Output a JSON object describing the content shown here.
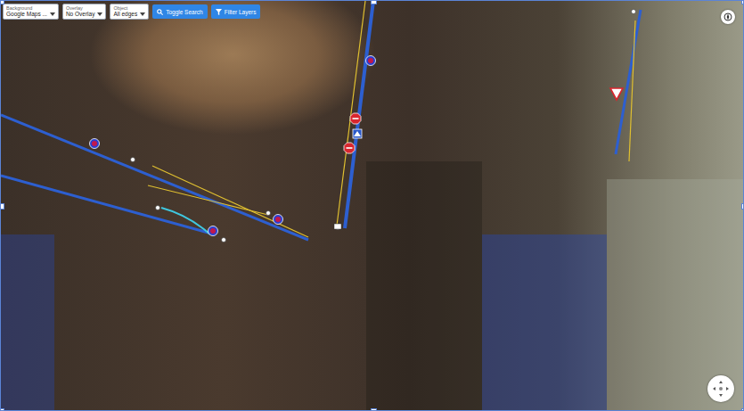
{
  "toolbar": {
    "selects": [
      {
        "label": "Background",
        "value": "Google Maps ..."
      },
      {
        "label": "Overlay",
        "value": "No Overlay"
      },
      {
        "label": "Object",
        "value": "All edges"
      }
    ],
    "buttons": [
      "Toggle Search",
      "Filter Layers"
    ]
  }
}
